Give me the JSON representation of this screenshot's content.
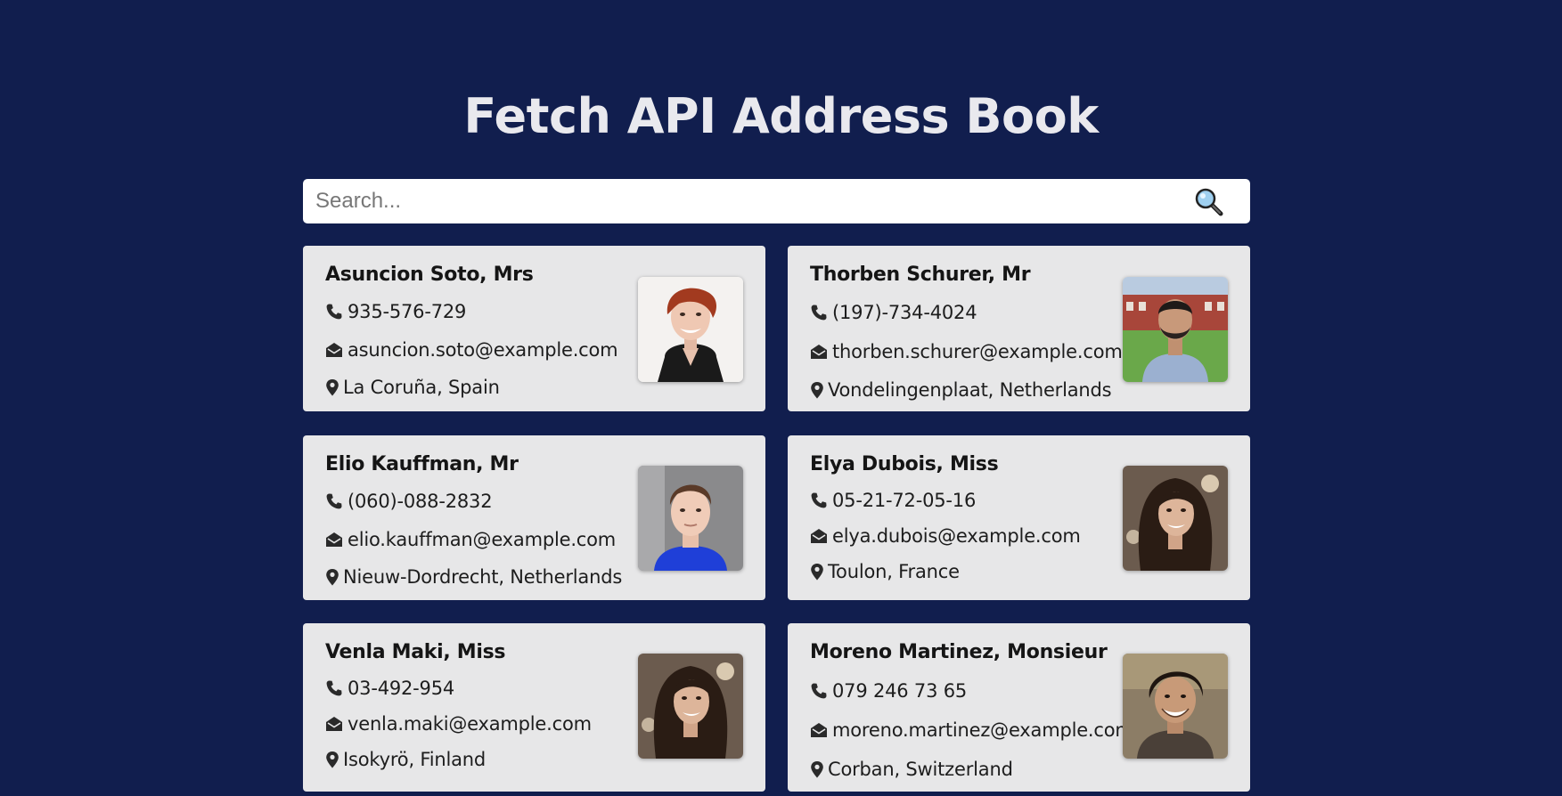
{
  "header": {
    "title": "Fetch API Address Book"
  },
  "search": {
    "placeholder": "Search...",
    "value": "",
    "icon": "magnifier-icon"
  },
  "contacts": [
    {
      "name": "Asuncion Soto, Mrs",
      "phone": "935-576-729",
      "email": "asuncion.soto@example.com",
      "location": "La Coruña, Spain",
      "photo": "woman-short-red-hair"
    },
    {
      "name": "Thorben Schurer, Mr",
      "phone": "(197)-734-4024",
      "email": "thorben.schurer@example.com",
      "location": "Vondelingenplaat, Netherlands",
      "photo": "man-beard-outdoors"
    },
    {
      "name": "Elio Kauffman, Mr",
      "phone": "(060)-088-2832",
      "email": "elio.kauffman@example.com",
      "location": "Nieuw-Dordrecht, Netherlands",
      "photo": "young-man-blue-shirt"
    },
    {
      "name": "Elya Dubois, Miss",
      "phone": "05-21-72-05-16",
      "email": "elya.dubois@example.com",
      "location": "Toulon, France",
      "photo": "woman-long-dark-hair"
    },
    {
      "name": "Venla Maki, Miss",
      "phone": "03-492-954",
      "email": "venla.maki@example.com",
      "location": "Isokyrö, Finland",
      "photo": "woman-long-dark-hair"
    },
    {
      "name": "Moreno Martinez, Monsieur",
      "phone": "079 246 73 65",
      "email": "moreno.martinez@example.com",
      "location": "Corban, Switzerland",
      "photo": "man-curly-hair-smiling"
    }
  ],
  "colors": {
    "background": "#111e4e",
    "card": "#e7e7e8",
    "title": "#e9e9ee"
  }
}
